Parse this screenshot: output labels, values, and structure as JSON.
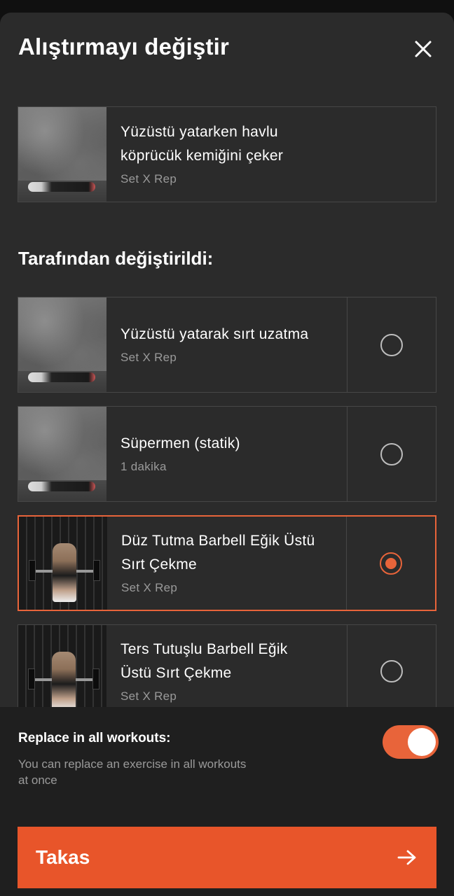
{
  "header": {
    "title": "Alıştırmayı değiştir",
    "close_icon": "close-icon"
  },
  "current_exercise": {
    "title_line1": "Yüzüstü yatarken havlu",
    "title_line2": "köprücük kemiğini çeker",
    "subtitle": "Set X Rep"
  },
  "section_title": "Tarafından değiştirildi:",
  "alternatives": [
    {
      "title_line1": "Yüzüstü yatarak sırt uzatma",
      "title_line2": "",
      "subtitle": "Set X Rep",
      "selected": false
    },
    {
      "title_line1": "Süpermen (statik)",
      "title_line2": "",
      "subtitle": "1 dakika",
      "selected": false
    },
    {
      "title_line1": "Düz Tutma Barbell Eğik Üstü",
      "title_line2": "Sırt Çekme",
      "subtitle": "Set X Rep",
      "selected": true
    },
    {
      "title_line1": "Ters Tutuşlu Barbell Eğik",
      "title_line2": "Üstü Sırt Çekme",
      "subtitle": "Set X Rep",
      "selected": false
    }
  ],
  "replace_all": {
    "label": "Replace in all workouts:",
    "description_line1": "You can replace an exercise in all workouts",
    "description_line2": "at once",
    "enabled": true
  },
  "primary_button": {
    "label": "Takas",
    "icon": "arrow-right-icon"
  },
  "colors": {
    "accent": "#e8643a",
    "button": "#e8552a",
    "background": "#2b2b2b",
    "panel": "#1f1f1f"
  }
}
